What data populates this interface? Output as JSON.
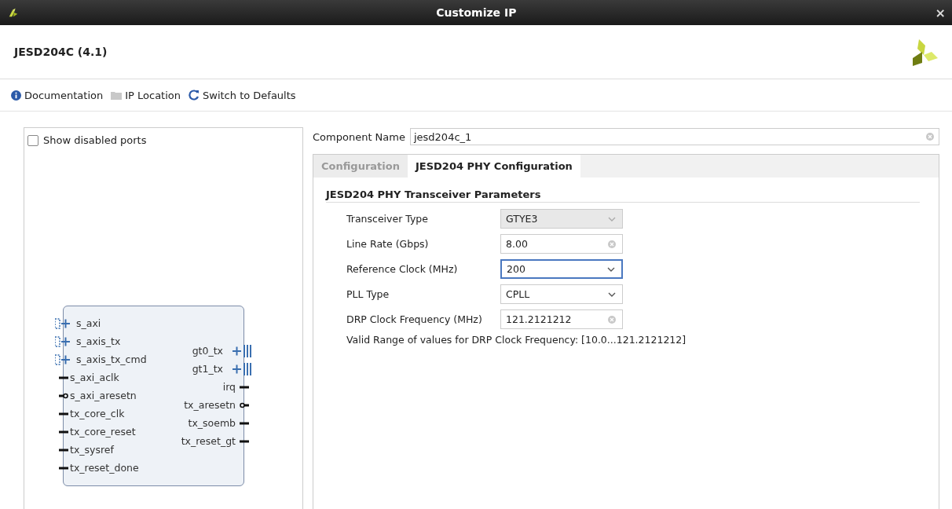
{
  "window": {
    "title": "Customize IP",
    "close": "×"
  },
  "header": {
    "title": "JESD204C (4.1)"
  },
  "toolbar": [
    {
      "kind": "info",
      "label": "Documentation"
    },
    {
      "kind": "folder",
      "label": "IP Location"
    },
    {
      "kind": "refresh",
      "label": "Switch to Defaults"
    }
  ],
  "symbol_panel": {
    "show_disabled_ports": {
      "label": "Show disabled ports",
      "checked": false
    },
    "left_ports": [
      {
        "name": "s_axi",
        "kind": "bus"
      },
      {
        "name": "s_axis_tx",
        "kind": "bus"
      },
      {
        "name": "s_axis_tx_cmd",
        "kind": "bus"
      },
      {
        "name": "s_axi_aclk",
        "kind": "wire"
      },
      {
        "name": "s_axi_aresetn",
        "kind": "inverted"
      },
      {
        "name": "tx_core_clk",
        "kind": "wire"
      },
      {
        "name": "tx_core_reset",
        "kind": "wire"
      },
      {
        "name": "tx_sysref",
        "kind": "wire"
      },
      {
        "name": "tx_reset_done",
        "kind": "wire"
      }
    ],
    "right_ports": [
      {
        "name": "gt0_tx",
        "kind": "bus"
      },
      {
        "name": "gt1_tx",
        "kind": "bus"
      },
      {
        "name": "irq",
        "kind": "wire"
      },
      {
        "name": "tx_aresetn",
        "kind": "inverted"
      },
      {
        "name": "tx_soemb",
        "kind": "wire"
      },
      {
        "name": "tx_reset_gt",
        "kind": "wire"
      }
    ]
  },
  "component_name": {
    "label": "Component Name",
    "value": "jesd204c_1"
  },
  "tabs": [
    {
      "label": "Configuration",
      "selected": false
    },
    {
      "label": "JESD204 PHY Configuration",
      "selected": true
    }
  ],
  "section": {
    "title": "JESD204 PHY Transceiver Parameters",
    "fields": [
      {
        "label": "Transceiver Type",
        "kind": "dropdown",
        "value": "GTYE3",
        "disabled": true,
        "focused": false
      },
      {
        "label": "Line Rate (Gbps)",
        "kind": "text",
        "value": "8.00",
        "disabled": false,
        "focused": false
      },
      {
        "label": "Reference Clock (MHz)",
        "kind": "dropdown",
        "value": "200",
        "disabled": false,
        "focused": true
      },
      {
        "label": "PLL Type",
        "kind": "dropdown",
        "value": "CPLL",
        "disabled": false,
        "focused": false
      },
      {
        "label": "DRP Clock Frequency (MHz)",
        "kind": "text",
        "value": "121.2121212",
        "disabled": false,
        "focused": false
      }
    ],
    "note": "Valid Range of values for DRP Clock Frequency: [10.0...121.2121212]"
  }
}
